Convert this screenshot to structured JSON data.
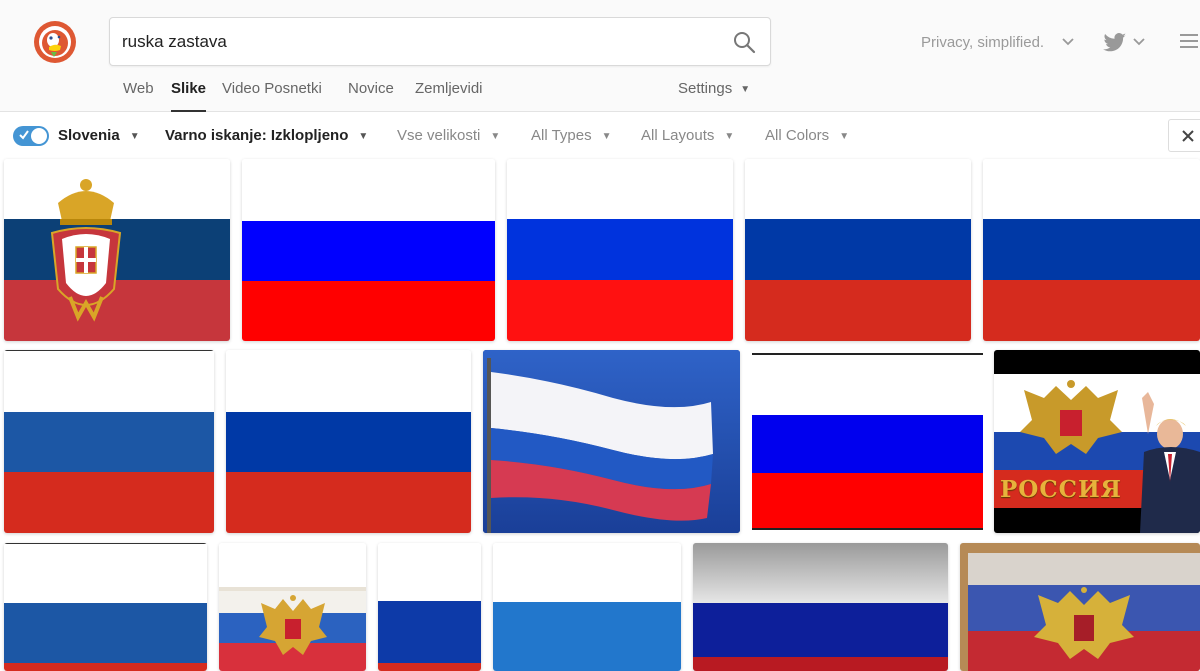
{
  "search": {
    "query": "ruska zastava"
  },
  "header": {
    "tagline": "Privacy, simplified."
  },
  "tabs": [
    {
      "label": "Web",
      "active": false
    },
    {
      "label": "Slike",
      "active": true
    },
    {
      "label": "Video Posnetki",
      "active": false
    },
    {
      "label": "Novice",
      "active": false
    },
    {
      "label": "Zemljevidi",
      "active": false
    }
  ],
  "settings": {
    "label": "Settings"
  },
  "filters": {
    "region": "Slovenia",
    "region_toggle_on": true,
    "safe_search": "Varno iskanje: Izklopljeno",
    "size": "Vse velikosti",
    "type": "All Types",
    "layout": "All Layouts",
    "color": "All Colors"
  },
  "colors": {
    "accent": "#4495d4",
    "russia_blue": "#0033a0",
    "russia_red": "#d52b1e",
    "serbia_blue": "#0c4076",
    "serbia_red": "#c6363c"
  },
  "results": [
    {
      "kind": "serbia-flag"
    },
    {
      "kind": "russia-flag"
    },
    {
      "kind": "russia-flag"
    },
    {
      "kind": "russia-flag"
    },
    {
      "kind": "russia-flag"
    },
    {
      "kind": "russia-flag"
    },
    {
      "kind": "russia-flag"
    },
    {
      "kind": "waving-flag-photo"
    },
    {
      "kind": "russia-flag"
    },
    {
      "kind": "russia-collage",
      "caption": "РОССИЯ"
    },
    {
      "kind": "russia-flag"
    },
    {
      "kind": "russia-patch"
    },
    {
      "kind": "russia-flag"
    },
    {
      "kind": "russia-flag"
    },
    {
      "kind": "grunge-flag"
    },
    {
      "kind": "eagle-flag"
    }
  ]
}
